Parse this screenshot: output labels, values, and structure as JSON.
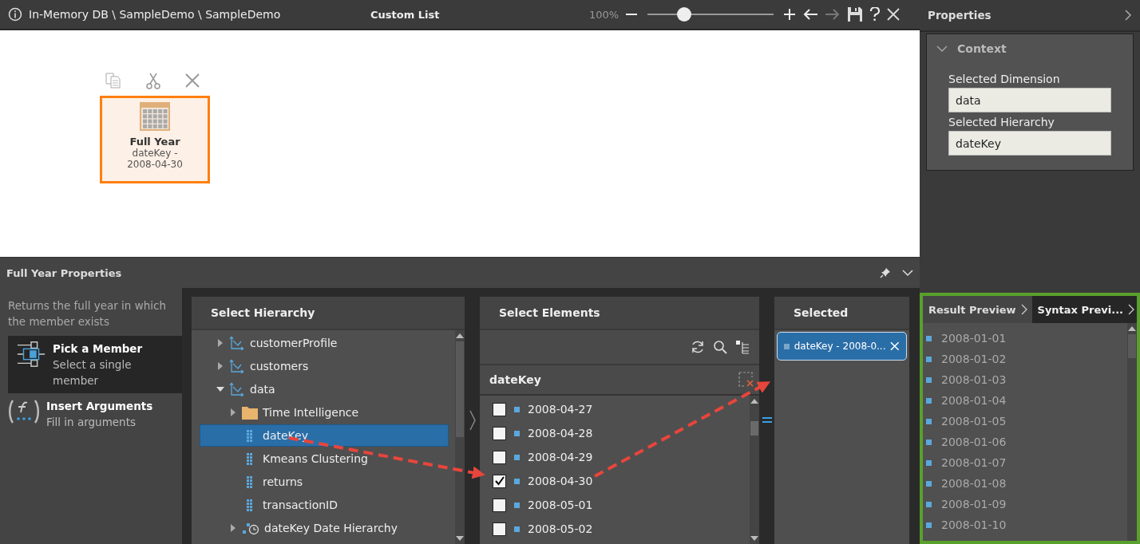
{
  "window": {
    "breadcrumb": "In-Memory DB \\ SampleDemo \\ SampleDemo",
    "title": "Custom List",
    "zoom": {
      "reading": "100%",
      "level": 0.29
    }
  },
  "canvas": {
    "card": {
      "title": "Full Year",
      "subtitle": "dateKey - 2008-04-30",
      "selected": true
    }
  },
  "properties_panel": {
    "title": "Properties",
    "section": {
      "title": "Context",
      "expanded": true,
      "fields": [
        {
          "label": "Selected Dimension",
          "value": "data"
        },
        {
          "label": "Selected Hierarchy",
          "value": "dateKey"
        }
      ]
    }
  },
  "bottom_panel": {
    "title": "Full Year Properties",
    "description": "Returns the full year in which the member exists",
    "modes": [
      {
        "kind": "pick",
        "title": "Pick a Member",
        "subtitle": "Select a single member",
        "selected": true
      },
      {
        "kind": "args",
        "title": "Insert Arguments",
        "subtitle": "Fill in arguments",
        "selected": false
      }
    ],
    "hierarchy": {
      "title": "Select Hierarchy",
      "items": [
        {
          "kind": "hierarchy",
          "label": "customerProfile",
          "expanded": false,
          "selected": false
        },
        {
          "kind": "hierarchy",
          "label": "customers",
          "expanded": false,
          "selected": false
        },
        {
          "kind": "hierarchy",
          "label": "data",
          "expanded": true,
          "selected": false,
          "children": [
            {
              "kind": "folder",
              "label": "Time Intelligence",
              "expanded": false,
              "selected": false
            },
            {
              "kind": "level",
              "label": "dateKey",
              "selected": true
            },
            {
              "kind": "level",
              "label": "Kmeans Clustering",
              "selected": false
            },
            {
              "kind": "level",
              "label": "returns",
              "selected": false
            },
            {
              "kind": "level",
              "label": "transactionID",
              "selected": false
            },
            {
              "kind": "date-hierarchy",
              "label": "dateKey Date Hierarchy",
              "expanded": false,
              "selected": false
            }
          ]
        }
      ]
    },
    "elements": {
      "title": "Select Elements",
      "level_name": "dateKey",
      "items": [
        {
          "label": "2008-04-27",
          "checked": false
        },
        {
          "label": "2008-04-28",
          "checked": false
        },
        {
          "label": "2008-04-29",
          "checked": false
        },
        {
          "label": "2008-04-30",
          "checked": true
        },
        {
          "label": "2008-05-01",
          "checked": false
        },
        {
          "label": "2008-05-02",
          "checked": false
        }
      ]
    },
    "selected": {
      "title": "Selected",
      "items": [
        "dateKey - 2008-0..."
      ]
    }
  },
  "preview": {
    "tabs": [
      {
        "label": "Result Preview",
        "selected": true
      },
      {
        "label": "Syntax Previ...",
        "selected": false
      }
    ],
    "items": [
      "2008-01-01",
      "2008-01-02",
      "2008-01-03",
      "2008-01-04",
      "2008-01-05",
      "2008-01-06",
      "2008-01-07",
      "2008-01-08",
      "2008-01-09",
      "2008-01-10"
    ]
  }
}
